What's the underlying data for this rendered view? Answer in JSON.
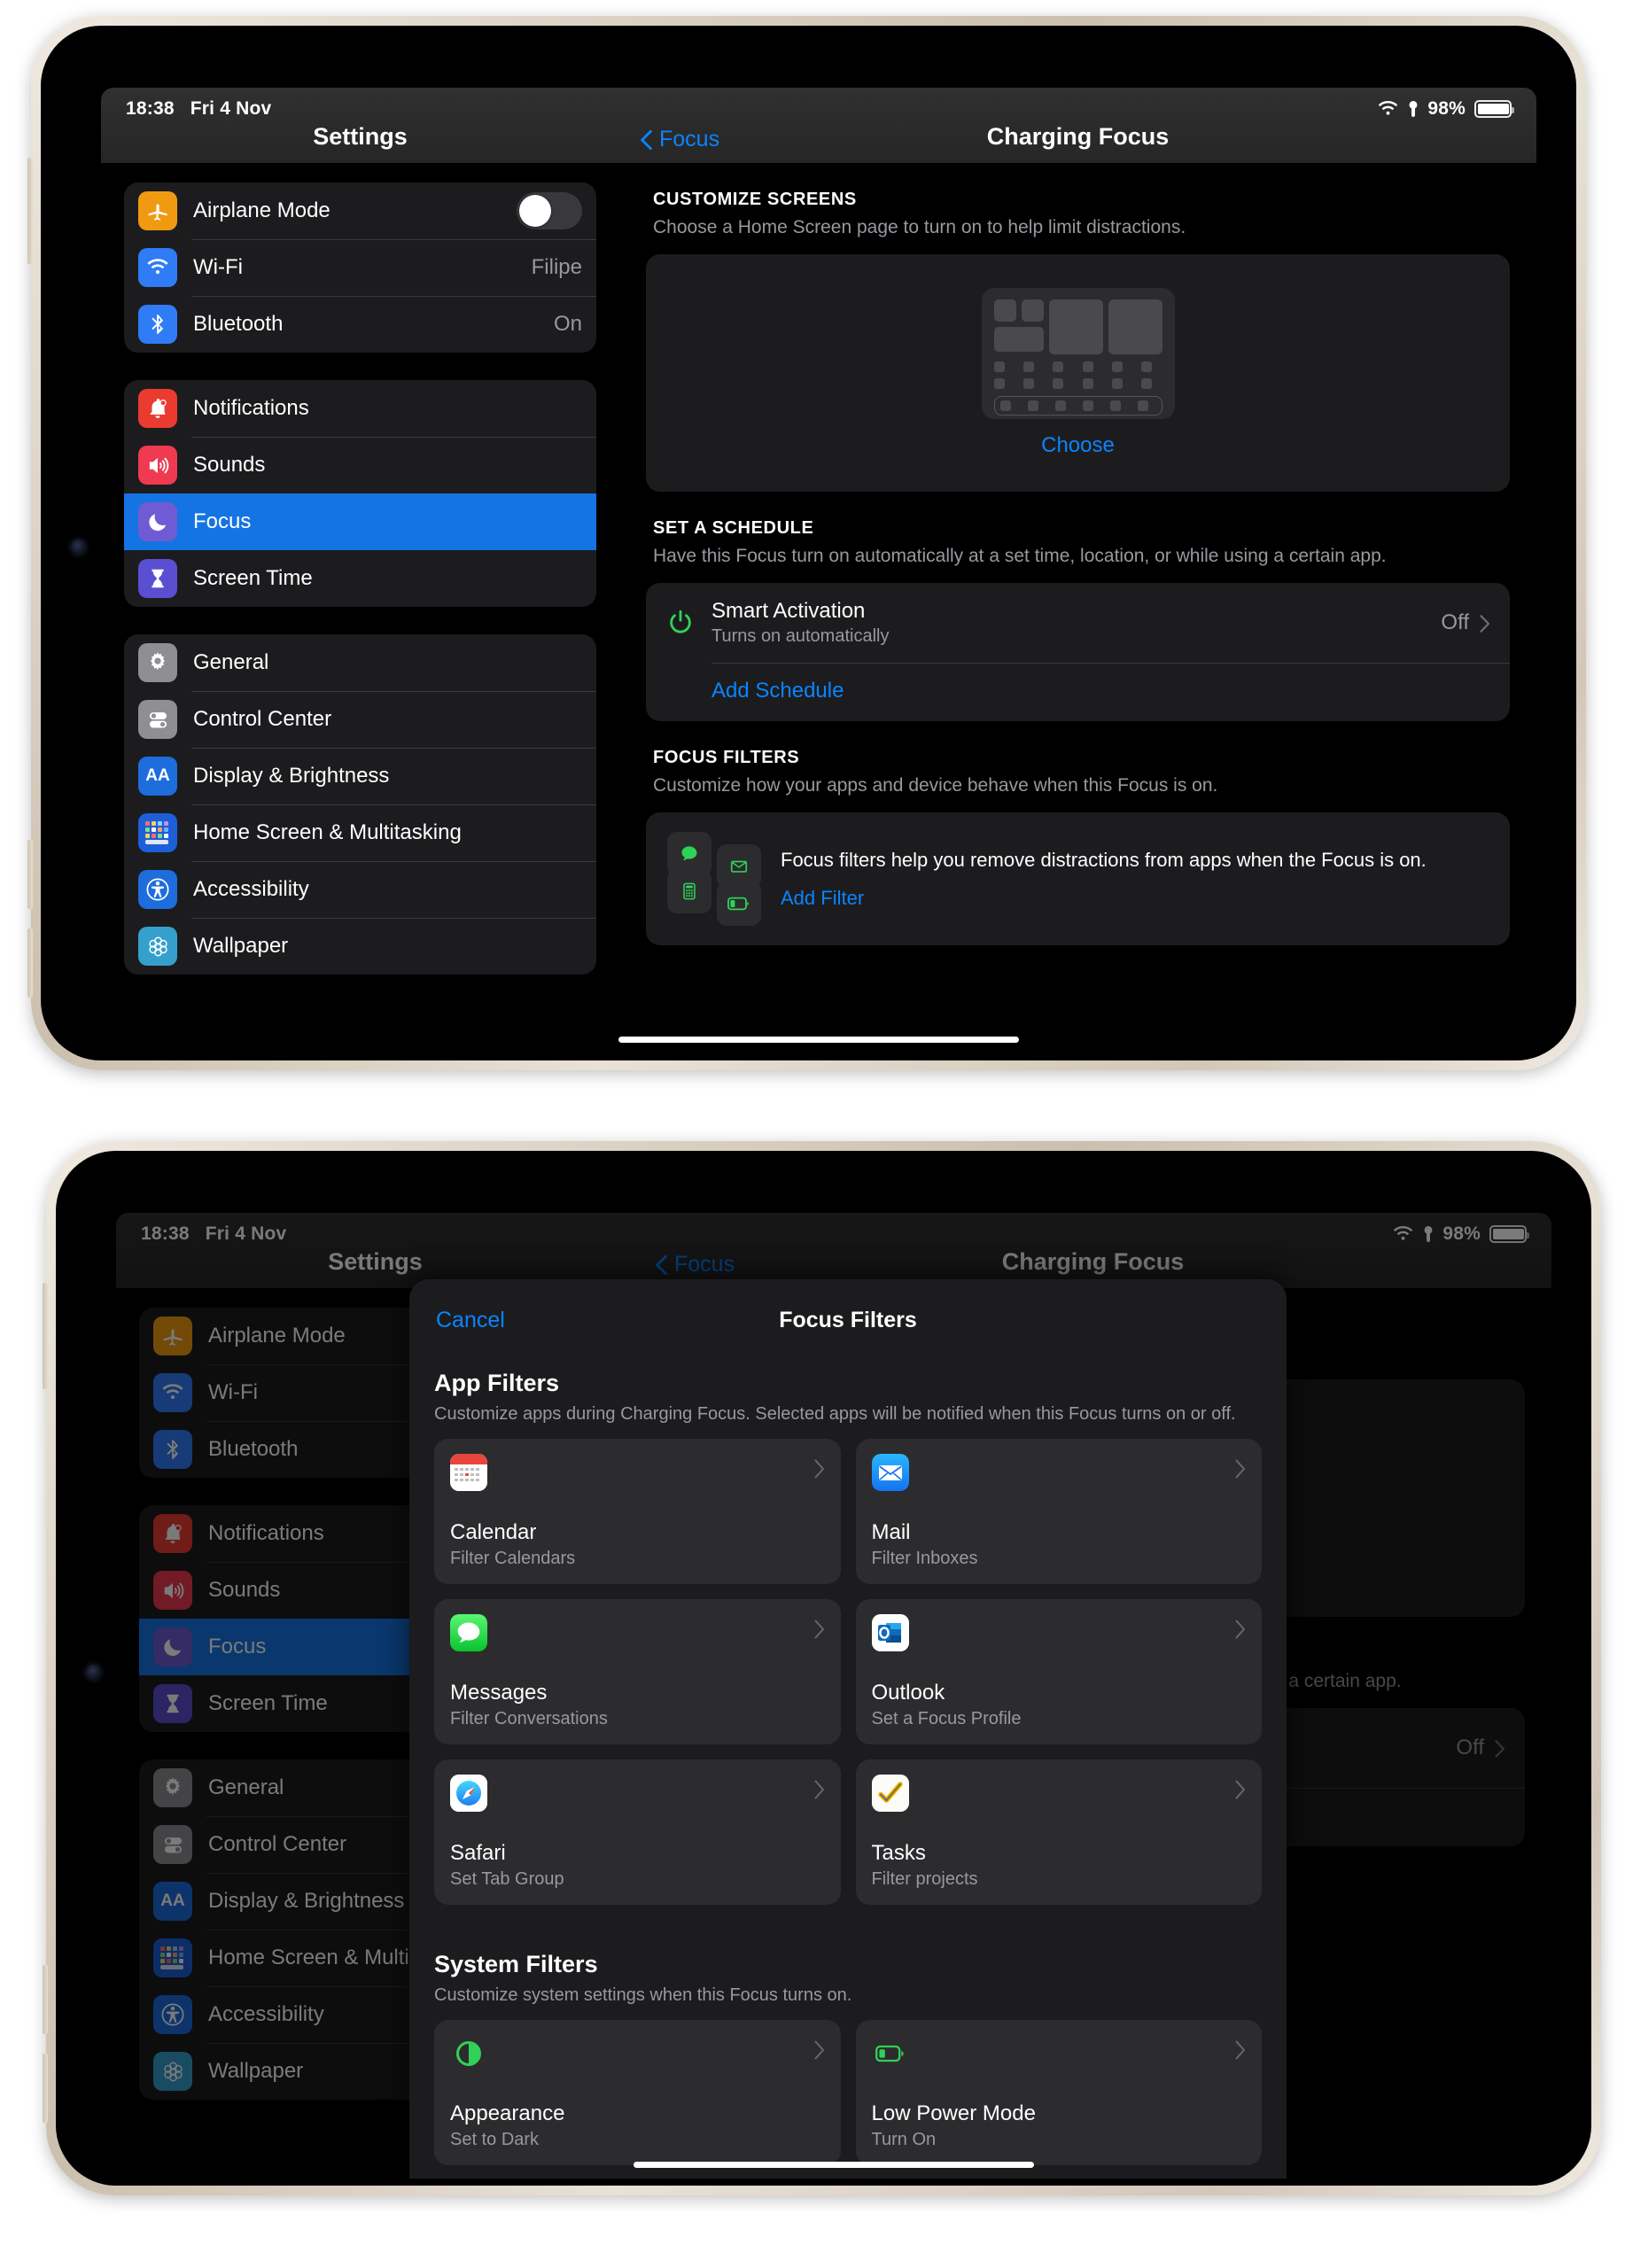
{
  "status_bar": {
    "time": "18:38",
    "date": "Fri 4 Nov",
    "battery_percent": "98%",
    "wifi_icon": "wifi-icon",
    "location_icon": "location-icon",
    "battery_icon": "battery-icon"
  },
  "sidebar": {
    "title": "Settings",
    "groups": [
      {
        "items": [
          {
            "label": "Airplane Mode",
            "value": "",
            "control": "toggle",
            "toggle_on": false,
            "icon": "airplane-icon",
            "icon_bg": "#f09a12"
          },
          {
            "label": "Wi-Fi",
            "value": "Filipe",
            "control": "value",
            "icon": "wifi-icon",
            "icon_bg": "#2f7cf6"
          },
          {
            "label": "Bluetooth",
            "value": "On",
            "control": "value",
            "icon": "bluetooth-icon",
            "icon_bg": "#2f7cf6"
          }
        ]
      },
      {
        "items": [
          {
            "label": "Notifications",
            "value": "",
            "control": "none",
            "icon": "notifications-bell-icon",
            "icon_bg": "#eb3b30",
            "selected": false
          },
          {
            "label": "Sounds",
            "value": "",
            "control": "none",
            "icon": "sounds-speaker-icon",
            "icon_bg": "#ef3a52",
            "selected": false
          },
          {
            "label": "Focus",
            "value": "",
            "control": "none",
            "icon": "focus-moon-icon",
            "icon_bg": "#6f5bd4",
            "selected": true
          },
          {
            "label": "Screen Time",
            "value": "",
            "control": "none",
            "icon": "screen-time-hourglass-icon",
            "icon_bg": "#5a4fd0",
            "selected": false
          }
        ]
      },
      {
        "items": [
          {
            "label": "General",
            "value": "",
            "control": "none",
            "icon": "gear-icon",
            "icon_bg": "#8e8e93"
          },
          {
            "label": "Control Center",
            "value": "",
            "control": "none",
            "icon": "control-center-sliders-icon",
            "icon_bg": "#8e8e93"
          },
          {
            "label": "Display & Brightness",
            "value": "",
            "control": "none",
            "icon": "display-aa-icon",
            "icon_bg": "#1d6ddd"
          },
          {
            "label": "Home Screen & Multitasking",
            "value": "",
            "control": "none",
            "icon": "home-screen-grid-icon",
            "icon_bg": "#1d5fd8"
          },
          {
            "label": "Accessibility",
            "value": "",
            "control": "none",
            "icon": "accessibility-icon",
            "icon_bg": "#1d6ddd"
          },
          {
            "label": "Wallpaper",
            "value": "",
            "control": "none",
            "icon": "wallpaper-flower-icon",
            "icon_bg": "#35a0cc"
          }
        ]
      }
    ]
  },
  "detail": {
    "back_label": "Focus",
    "title": "Charging Focus",
    "customize_screens": {
      "header": "CUSTOMIZE SCREENS",
      "subtitle": "Choose a Home Screen page to turn on to help limit distractions.",
      "choose_label": "Choose"
    },
    "schedule": {
      "header": "SET A SCHEDULE",
      "subtitle": "Have this Focus turn on automatically at a set time, location, or while using a certain app.",
      "smart_activation_title": "Smart Activation",
      "smart_activation_sub": "Turns on automatically",
      "smart_activation_value": "Off",
      "add_schedule_label": "Add Schedule",
      "power_icon": "power-icon"
    },
    "focus_filters": {
      "header": "FOCUS FILTERS",
      "subtitle": "Customize how your apps and device behave when this Focus is on.",
      "description": "Focus filters help you remove distractions from apps when the Focus is on.",
      "add_filter_label": "Add Filter",
      "tile_icons": [
        "messages-bubble-icon",
        "mail-envelope-icon",
        "calculator-icon",
        "low-power-battery-icon"
      ]
    }
  },
  "sheet": {
    "cancel_label": "Cancel",
    "title": "Focus Filters",
    "app_filters": {
      "title": "App Filters",
      "subtitle": "Customize apps during Charging Focus. Selected apps will be notified when this Focus turns on or off.",
      "cards": [
        {
          "name": "Calendar",
          "sub": "Filter Calendars",
          "icon": "calendar-app-icon"
        },
        {
          "name": "Mail",
          "sub": "Filter Inboxes",
          "icon": "mail-app-icon"
        },
        {
          "name": "Messages",
          "sub": "Filter Conversations",
          "icon": "messages-app-icon"
        },
        {
          "name": "Outlook",
          "sub": "Set a Focus Profile",
          "icon": "outlook-app-icon"
        },
        {
          "name": "Safari",
          "sub": "Set Tab Group",
          "icon": "safari-app-icon"
        },
        {
          "name": "Tasks",
          "sub": "Filter projects",
          "icon": "tasks-app-icon"
        }
      ]
    },
    "system_filters": {
      "title": "System Filters",
      "subtitle": "Customize system settings when this Focus turns on.",
      "cards": [
        {
          "name": "Appearance",
          "sub": "Set to Dark",
          "icon": "appearance-icon"
        },
        {
          "name": "Low Power Mode",
          "sub": "Turn On",
          "icon": "low-power-mode-icon"
        }
      ]
    }
  },
  "colors": {
    "accent_blue": "#0a84ff",
    "selection_blue": "#1574e3",
    "green": "#30d158",
    "card_bg": "#1c1c1e",
    "tile_bg": "#2c2c2e",
    "secondary_text": "#98989f"
  }
}
